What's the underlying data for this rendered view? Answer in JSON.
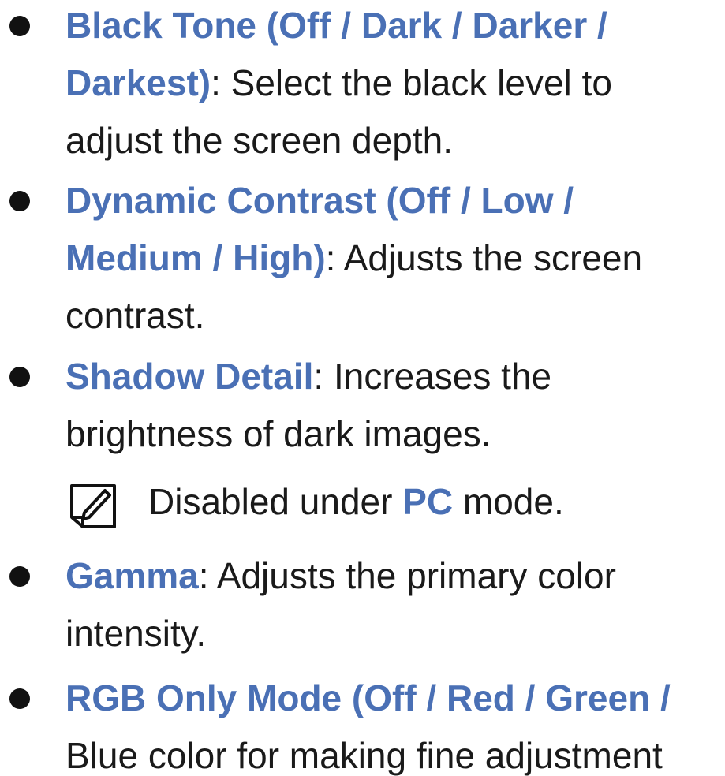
{
  "colors": {
    "term": "#4a70b5",
    "text": "#1a1a1a"
  },
  "items": [
    {
      "term_line1": "Black Tone (Off / Dark / Darker /",
      "term_line2": "Darkest)",
      "desc_line2": ": Select the black level to",
      "desc_line3": "adjust the screen depth."
    },
    {
      "term_line1": "Dynamic Contrast (Off / Low /",
      "term_line2": "Medium / High)",
      "desc_line2": ": Adjusts the screen",
      "desc_line3": "contrast."
    },
    {
      "term": "Shadow Detail",
      "desc_line1": ": Increases the",
      "desc_line2": "brightness of dark images."
    },
    {
      "term": "Gamma",
      "desc_line1": ": Adjusts the primary color",
      "desc_line2": "intensity."
    },
    {
      "term_line1": "RGB Only Mode (Off / Red / Green /",
      "desc_line2": "Blue color for making fine adjustment"
    }
  ],
  "note": {
    "icon": "note-pencil-icon",
    "text_before": "Disabled under ",
    "highlight": "PC",
    "text_after": " mode."
  }
}
